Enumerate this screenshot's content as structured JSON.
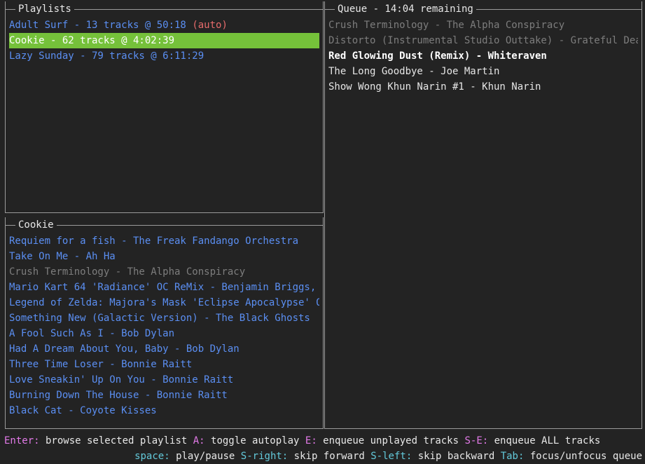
{
  "playlists": {
    "title": "Playlists",
    "items": [
      {
        "label": "Adult Surf - 13 tracks @ 50:18",
        "suffix": "(auto)"
      },
      {
        "label": "Cookie - 62 tracks @ 4:02:39",
        "suffix": ""
      },
      {
        "label": "Lazy Sunday - 79 tracks @ 6:11:29",
        "suffix": ""
      }
    ],
    "selected_index": 1
  },
  "tracks": {
    "title": "Cookie",
    "items": [
      {
        "label": "Requiem for a fish - The Freak Fandango Orchestra",
        "played": false
      },
      {
        "label": "Take On Me - Ah Ha",
        "played": false
      },
      {
        "label": "Crush Terminology - The Alpha Conspiracy",
        "played": true
      },
      {
        "label": "Mario Kart 64 'Radiance' OC ReMix - Benjamin Briggs,",
        "played": false
      },
      {
        "label": "Legend of Zelda: Majora's Mask 'Eclipse Apocalypse' OC",
        "played": false
      },
      {
        "label": "Something New (Galactic Version) - The Black Ghosts",
        "played": false
      },
      {
        "label": "A Fool Such As I - Bob Dylan",
        "played": false
      },
      {
        "label": "Had A Dream About You, Baby - Bob Dylan",
        "played": false
      },
      {
        "label": "Three Time Loser - Bonnie Raitt",
        "played": false
      },
      {
        "label": "Love Sneakin' Up On You - Bonnie Raitt",
        "played": false
      },
      {
        "label": "Burning Down The House - Bonnie Raitt",
        "played": false
      },
      {
        "label": "Black Cat - Coyote Kisses",
        "played": false
      }
    ]
  },
  "queue": {
    "title": "Queue - 14:04 remaining",
    "items": [
      {
        "label": "Crush Terminology - The Alpha Conspiracy",
        "state": "played"
      },
      {
        "label": "Distorto (Instrumental Studio Outtake) - Grateful Dead",
        "state": "played"
      },
      {
        "label": "Red Glowing Dust (Remix) - Whiteraven",
        "state": "current"
      },
      {
        "label": "The Long Goodbye - Joe Martin",
        "state": "upcoming"
      },
      {
        "label": "Show Wong Khun Narin #1 - Khun Narin",
        "state": "upcoming"
      }
    ]
  },
  "help": {
    "line1": [
      {
        "key": "Enter:",
        "desc": " browse selected playlist "
      },
      {
        "key": "A:",
        "desc": " toggle autoplay "
      },
      {
        "key": "E:",
        "desc": " enqueue unplayed tracks "
      },
      {
        "key": "S-E:",
        "desc": " enqueue ALL tracks"
      }
    ],
    "line2": [
      {
        "key": "space:",
        "desc": " play/pause "
      },
      {
        "key": "S-right:",
        "desc": " skip forward "
      },
      {
        "key": "S-left:",
        "desc": " skip backward "
      },
      {
        "key": "Tab:",
        "desc": " focus/unfocus queue"
      }
    ]
  },
  "colors": {
    "background": "#232323",
    "selection": "#75c13a",
    "unplayed": "#5b8ff3",
    "played": "#7d7d7d",
    "auto_tag": "#e66b6b",
    "key_line1": "#e27ae8",
    "key_line2": "#63c9da"
  }
}
